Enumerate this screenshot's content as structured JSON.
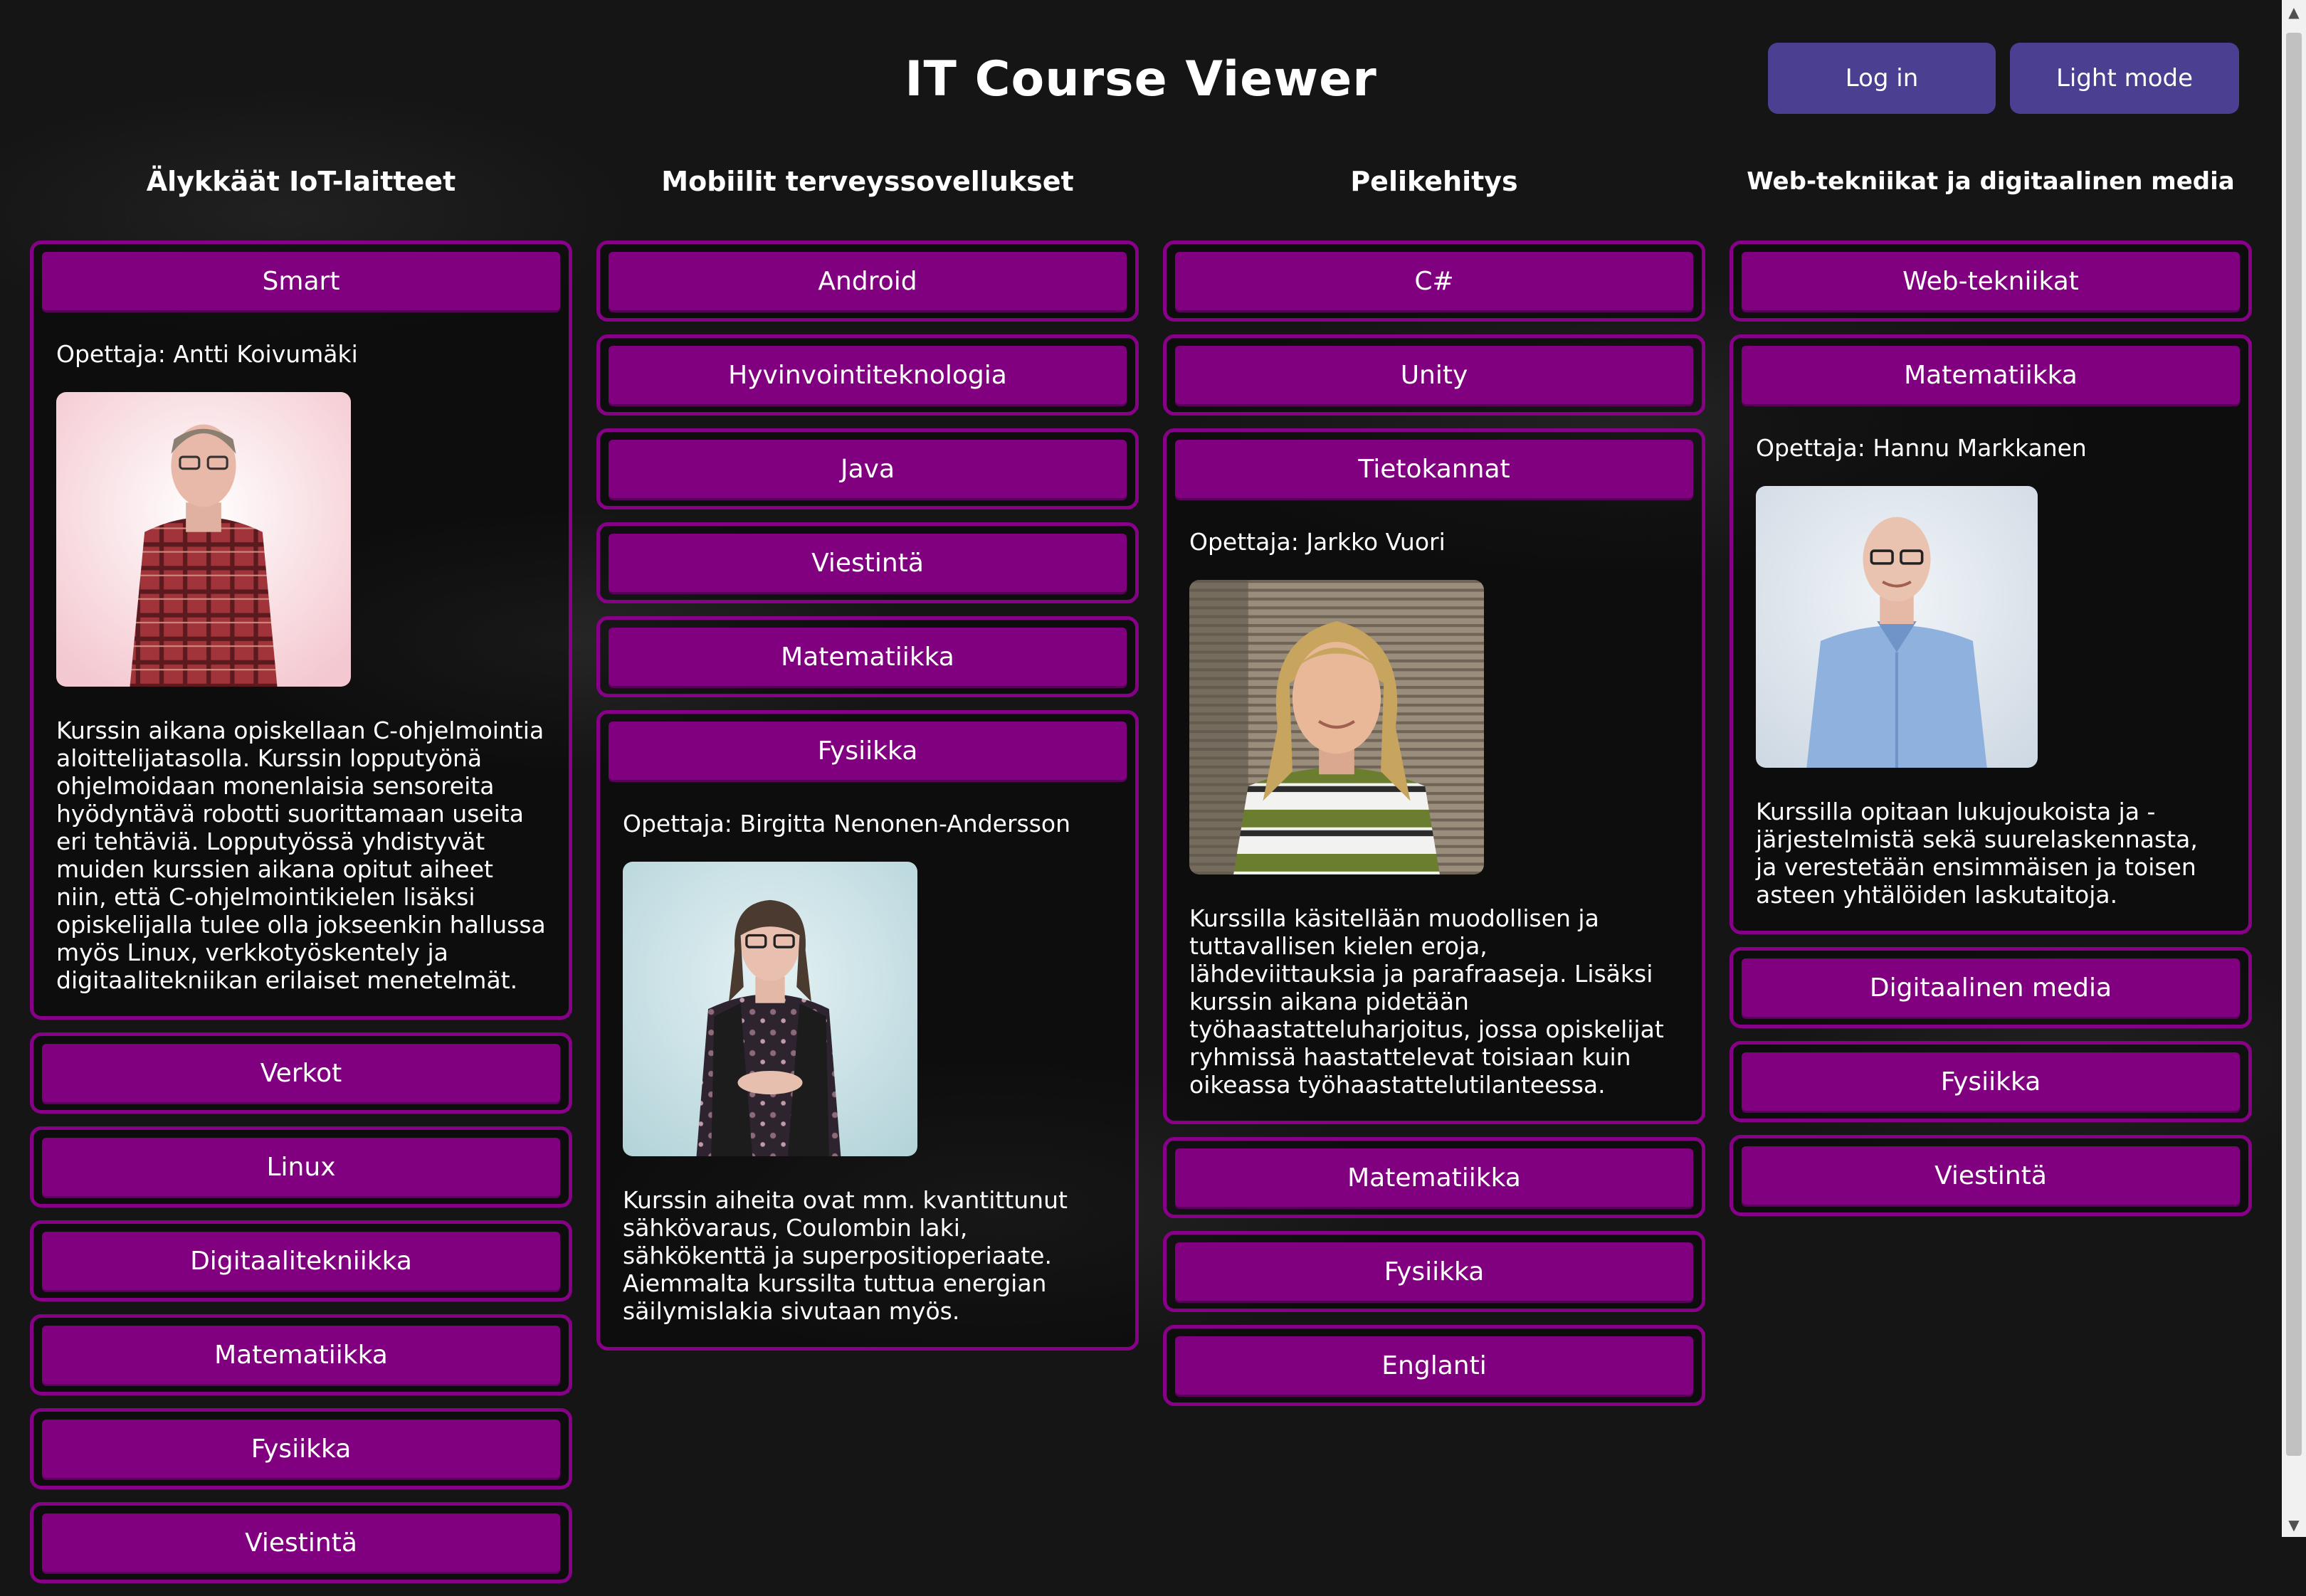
{
  "header": {
    "title": "IT Course Viewer",
    "login_label": "Log in",
    "mode_label": "Light mode"
  },
  "colors": {
    "accent": "#800080",
    "card_border": "#880088",
    "header_button": "#4b3f92",
    "background": "#151515"
  },
  "columns": [
    {
      "title": "Älykkäät IoT-laitteet",
      "courses": [
        {
          "name": "Smart",
          "expanded": true,
          "teacher": "Opettaja: Antti Koivumäki",
          "photo": "teacher-photo-antti",
          "description": "Kurssin aikana opiskellaan C-ohjelmointia aloittelijatasolla. Kurssin lopputyönä ohjelmoidaan monenlaisia sensoreita hyödyntävä robotti suorittamaan useita eri tehtäviä. Lopputyössä yhdistyvät muiden kurssien aikana opitut aiheet niin, että C-ohjelmointikielen lisäksi opiskelijalla tulee olla jokseenkin hallussa myös Linux, verkkotyöskentely ja digitaalitekniikan erilaiset menetelmät."
        },
        {
          "name": "Verkot"
        },
        {
          "name": "Linux"
        },
        {
          "name": "Digitaalitekniikka"
        },
        {
          "name": "Matematiikka"
        },
        {
          "name": "Fysiikka"
        },
        {
          "name": "Viestintä"
        }
      ]
    },
    {
      "title": "Mobiilit terveyssovellukset",
      "courses": [
        {
          "name": "Android"
        },
        {
          "name": "Hyvinvointiteknologia"
        },
        {
          "name": "Java"
        },
        {
          "name": "Viestintä"
        },
        {
          "name": "Matematiikka"
        },
        {
          "name": "Fysiikka",
          "expanded": true,
          "teacher": "Opettaja: Birgitta Nenonen-Andersson",
          "photo": "teacher-photo-birgitta",
          "description": "Kurssin aiheita ovat mm. kvantittunut sähkövaraus, Coulombin laki, sähkökenttä ja superpositioperiaate. Aiemmalta kurssilta tuttua energian säilymislakia sivutaan myös."
        }
      ]
    },
    {
      "title": "Pelikehitys",
      "courses": [
        {
          "name": "C#"
        },
        {
          "name": "Unity"
        },
        {
          "name": "Tietokannat",
          "expanded": true,
          "teacher": "Opettaja: Jarkko Vuori",
          "photo": "teacher-photo-jarkko",
          "description": "Kurssilla käsitellään muodollisen ja tuttavallisen kielen eroja, lähdeviittauksia ja parafraaseja. Lisäksi kurssin aikana pidetään työhaastatteluharjoitus, jossa opiskelijat ryhmissä haastattelevat toisiaan kuin oikeassa työhaastattelutilanteessa."
        },
        {
          "name": "Matematiikka"
        },
        {
          "name": "Fysiikka"
        },
        {
          "name": "Englanti"
        }
      ]
    },
    {
      "title": "Web-tekniikat ja digitaalinen media",
      "courses": [
        {
          "name": "Web-tekniikat"
        },
        {
          "name": "Matematiikka",
          "expanded": true,
          "teacher": "Opettaja: Hannu Markkanen",
          "photo": "teacher-photo-hannu",
          "description": "Kurssilla opitaan lukujoukoista ja -järjestelmistä sekä suurelaskennasta, ja verestetään ensimmäisen ja toisen asteen yhtälöiden laskutaitoja."
        },
        {
          "name": "Digitaalinen media"
        },
        {
          "name": "Fysiikka"
        },
        {
          "name": "Viestintä"
        }
      ]
    }
  ]
}
